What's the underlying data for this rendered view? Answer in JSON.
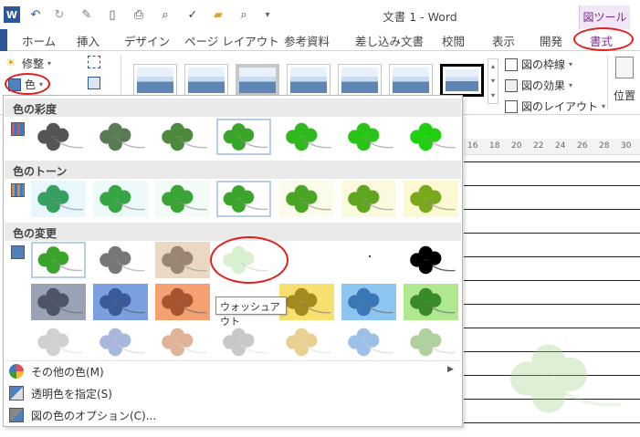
{
  "window": {
    "title": "文書 1 - Word",
    "context_tab_group": "図ツール",
    "qat_icons": [
      "word-logo-icon",
      "undo-icon",
      "repeat-icon",
      "quick-edit-icon",
      "new-document-icon",
      "print-icon",
      "print-preview-icon",
      "spelling-icon",
      "open-folder-icon",
      "search-icon",
      "customize-qat-icon"
    ]
  },
  "tabs": [
    {
      "label": "ホーム"
    },
    {
      "label": "挿入"
    },
    {
      "label": "デザイン"
    },
    {
      "label": "ページ レイアウト"
    },
    {
      "label": "参考資料"
    },
    {
      "label": "差し込み文書"
    },
    {
      "label": "校閲"
    },
    {
      "label": "表示"
    },
    {
      "label": "開発"
    },
    {
      "label": "書式"
    }
  ],
  "ribbon": {
    "corrections": "修整",
    "color": "色",
    "picture_border": "図の枠線",
    "picture_effects": "図の効果",
    "picture_layout": "図のレイアウト",
    "position": "位置"
  },
  "ruler": [
    "16",
    "18",
    "20",
    "22",
    "24",
    "26",
    "28",
    "30"
  ],
  "panel": {
    "sections": [
      {
        "title": "色の彩度"
      },
      {
        "title": "色のトーン"
      },
      {
        "title": "色の変更"
      }
    ],
    "tooltip": "ウォッシュアウト",
    "menu": [
      {
        "label": "その他の色(M)",
        "icon": "color-wheel-icon"
      },
      {
        "label": "透明色を指定(S)",
        "icon": "set-transparent-color-icon"
      },
      {
        "label": "図の色のオプション(C)...",
        "icon": "picture-color-options-icon"
      }
    ]
  },
  "colors": {
    "accent": "#2b579a",
    "context": "#7a2a8c",
    "annotation": "#e02020"
  }
}
